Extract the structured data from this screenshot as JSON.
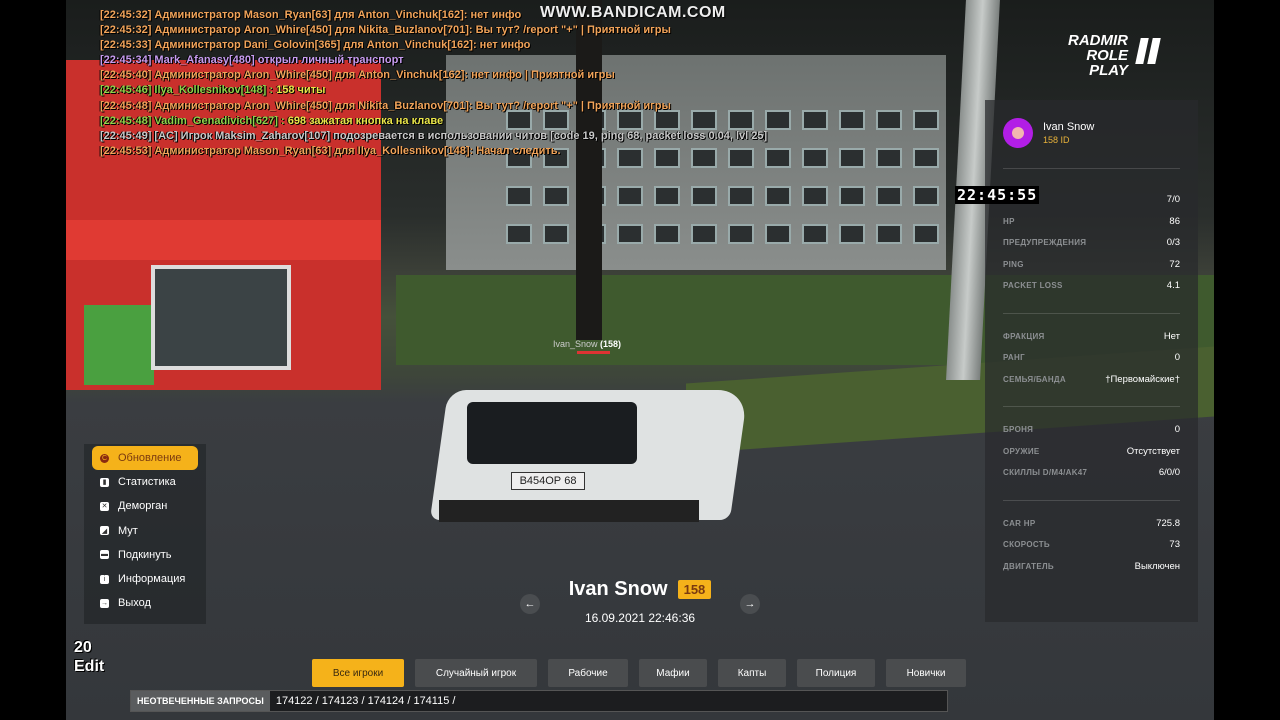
{
  "watermark": "WWW.BANDICAM.COM",
  "logo": {
    "line1": "RADMIR",
    "line2": "ROLE PLAY"
  },
  "chat": [
    {
      "color": "admin",
      "text": "[22:45:32] Администратор Mason_Ryan[63] для Anton_Vinchuk[162]: нет инфо"
    },
    {
      "color": "admin",
      "text": "[22:45:32] Администратор Aron_Whire[450] для Nikita_Buzlanov[701]: Вы тут? /report \"+\" | Приятной игры"
    },
    {
      "color": "admin",
      "text": "[22:45:33] Администратор Dani_Golovin[365] для Anton_Vinchuk[162]: нет инфо"
    },
    {
      "color": "purple",
      "text": "[22:45:34] Mark_Afanasy[480] открыл личный транспорт"
    },
    {
      "color": "admin",
      "text": "[22:45:40] Администратор Aron_Whire[450] для Anton_Vinchuk[162]: нет инфо | Приятной игры"
    },
    {
      "color": "green",
      "text": "[22:45:46] Ilya_Kollesnikov[148] :",
      "msg": " 158 читы"
    },
    {
      "color": "admin",
      "text": "[22:45:48] Администратор Aron_Whire[450] для Nikita_Buzlanov[701]: Вы тут? /report \"+\" | Приятной игры"
    },
    {
      "color": "green",
      "text": "[22:45:48] Vadim_Genadivich[627] :",
      "msg": " 698 зажатая кнопка на клаве"
    },
    {
      "color": "gray",
      "text": "[22:45:49] [AC] Игрок Maksim_Zaharov[107] подозревается в использовании читов [code 19, ping 68, packet loss 0.04, lvl 25]"
    },
    {
      "color": "admin",
      "text": "[22:45:53] Администратор Mason_Ryan[63] для Ilya_Kollesnikov[148]: Начал следить."
    }
  ],
  "nametag": {
    "name": "Ivan_Snow",
    "id": "(158)"
  },
  "plate": "В454ОР 68",
  "clock": "22:45:55",
  "panel": {
    "name": "Ivan Snow",
    "id": "158 ID",
    "groups": [
      [
        {
          "label": "",
          "value": "7/0"
        },
        {
          "label": "HP",
          "value": "86"
        },
        {
          "label": "ПРЕДУПРЕЖДЕНИЯ",
          "value": "0/3"
        },
        {
          "label": "PING",
          "value": "72"
        },
        {
          "label": "PACKET LOSS",
          "value": "4.1"
        }
      ],
      [
        {
          "label": "ФРАКЦИЯ",
          "value": "Нет"
        },
        {
          "label": "РАНГ",
          "value": "0"
        },
        {
          "label": "СЕМЬЯ/БАНДА",
          "value": "†Первомайские†"
        }
      ],
      [
        {
          "label": "БРОНЯ",
          "value": "0"
        },
        {
          "label": "ОРУЖИЕ",
          "value": "Отсутствует"
        },
        {
          "label": "СКИЛЛЫ D/M4/AK47",
          "value": "6/0/0"
        }
      ],
      [
        {
          "label": "CAR HP",
          "value": "725.8"
        },
        {
          "label": "СКОРОСТЬ",
          "value": "73"
        },
        {
          "label": "ДВИГАТЕЛЬ",
          "value": "Выключен"
        }
      ]
    ]
  },
  "menu": [
    {
      "label": "Обновление",
      "icon": "refresh-icon",
      "active": true
    },
    {
      "label": "Статистика",
      "icon": "stats-icon"
    },
    {
      "label": "Деморган",
      "icon": "x-icon"
    },
    {
      "label": "Мут",
      "icon": "mute-icon"
    },
    {
      "label": "Подкинуть",
      "icon": "throw-icon"
    },
    {
      "label": "Информация",
      "icon": "info-icon"
    },
    {
      "label": "Выход",
      "icon": "exit-icon"
    }
  ],
  "fps": {
    "value": "20",
    "label": "Edit"
  },
  "spectate": {
    "name": "Ivan Snow",
    "id": "158",
    "datetime": "16.09.2021 22:46:36",
    "prev": "←",
    "next": "→"
  },
  "tabs": [
    {
      "label": "Все игроки",
      "active": true
    },
    {
      "label": "Случайный игрок"
    },
    {
      "label": "Рабочие"
    },
    {
      "label": "Мафии"
    },
    {
      "label": "Капты"
    },
    {
      "label": "Полиция"
    },
    {
      "label": "Новички"
    }
  ],
  "requests": {
    "label": "НЕОТВЕЧЕННЫЕ ЗАПРОСЫ",
    "value": "174122 / 174123 / 174124 / 174115 /"
  },
  "colors": {
    "accent": "#f5b21a",
    "admin": "#f2a45a",
    "purple": "#c79cf0",
    "green": "#8fd24a",
    "avatar": "#b21ee6"
  }
}
